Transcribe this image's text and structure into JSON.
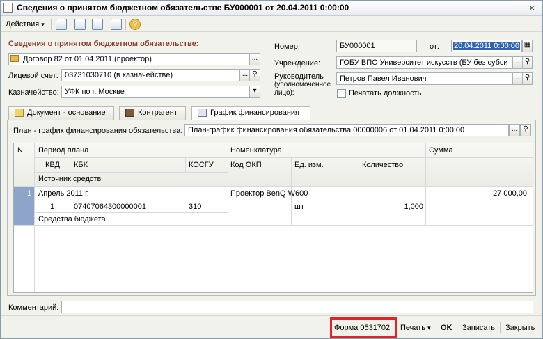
{
  "window": {
    "title": "Сведения о принятом бюджетном обязательстве БУ000001 от 20.04.2011 0:00:00",
    "close_symbol": "×"
  },
  "toolbar": {
    "actions_label": "Действия",
    "help_symbol": "?"
  },
  "left": {
    "section_title": "Сведения о принятом бюджетном обязательстве:",
    "contract_value": "Договор 82 от 01.04.2011 (проектор)",
    "account_label": "Лицевой счет:",
    "account_value": "03731030710 (в казначействе)",
    "treasury_label": "Казначейство:",
    "treasury_value": "УФК по г. Москве"
  },
  "right": {
    "number_label": "Номер:",
    "number_value": "БУ000001",
    "date_label": "от:",
    "date_value": "20.04.2011 0:00:00",
    "institution_label": "Учреждение:",
    "institution_value": "ГОБУ ВПО Университет искусств (БУ без субси",
    "head_label_1": "Руководитель",
    "head_label_2": "(уполномоченное",
    "head_label_3": "лицо):",
    "head_value": "Петров Павел Иванович",
    "print_position_label": "Печатать должность"
  },
  "tabs": [
    {
      "label": "Документ - основание"
    },
    {
      "label": "Контрагент"
    },
    {
      "label": "График финансирования"
    }
  ],
  "schedule": {
    "label": "План - график финансирования обязательства:",
    "value": "План-график финансирования обязательства 00000006 от 01.04.2011 0:00:00"
  },
  "table": {
    "headers": {
      "n": "N",
      "period": "Период плана",
      "kvd": "КВД",
      "kbk": "КБК",
      "kosgu": "КОСГУ",
      "source": "Источник средств",
      "nomenclature": "Номенклатура",
      "okp": "Код ОКП",
      "unit": "Ед. изм.",
      "qty": "Количество",
      "sum": "Сумма"
    },
    "row": {
      "n": "1",
      "period": "Апрель 2011 г.",
      "kvd": "1",
      "kbk": "07407064300000001",
      "kosgu": "310",
      "source": "Средства бюджета",
      "nomenclature": "Проектор BenQ W600",
      "unit": "шт",
      "qty": "1,000",
      "sum": "27 000,00"
    }
  },
  "footer": {
    "comment_label": "Комментарий:",
    "comment_value": "",
    "form_button": "Форма 0531702",
    "print_button": "Печать",
    "ok_button": "OK",
    "save_button": "Записать",
    "close_button": "Закрыть"
  },
  "colors": {
    "accent_title": "#8b3f2b",
    "highlight": "#e12226",
    "selection": "#2f64b4"
  }
}
